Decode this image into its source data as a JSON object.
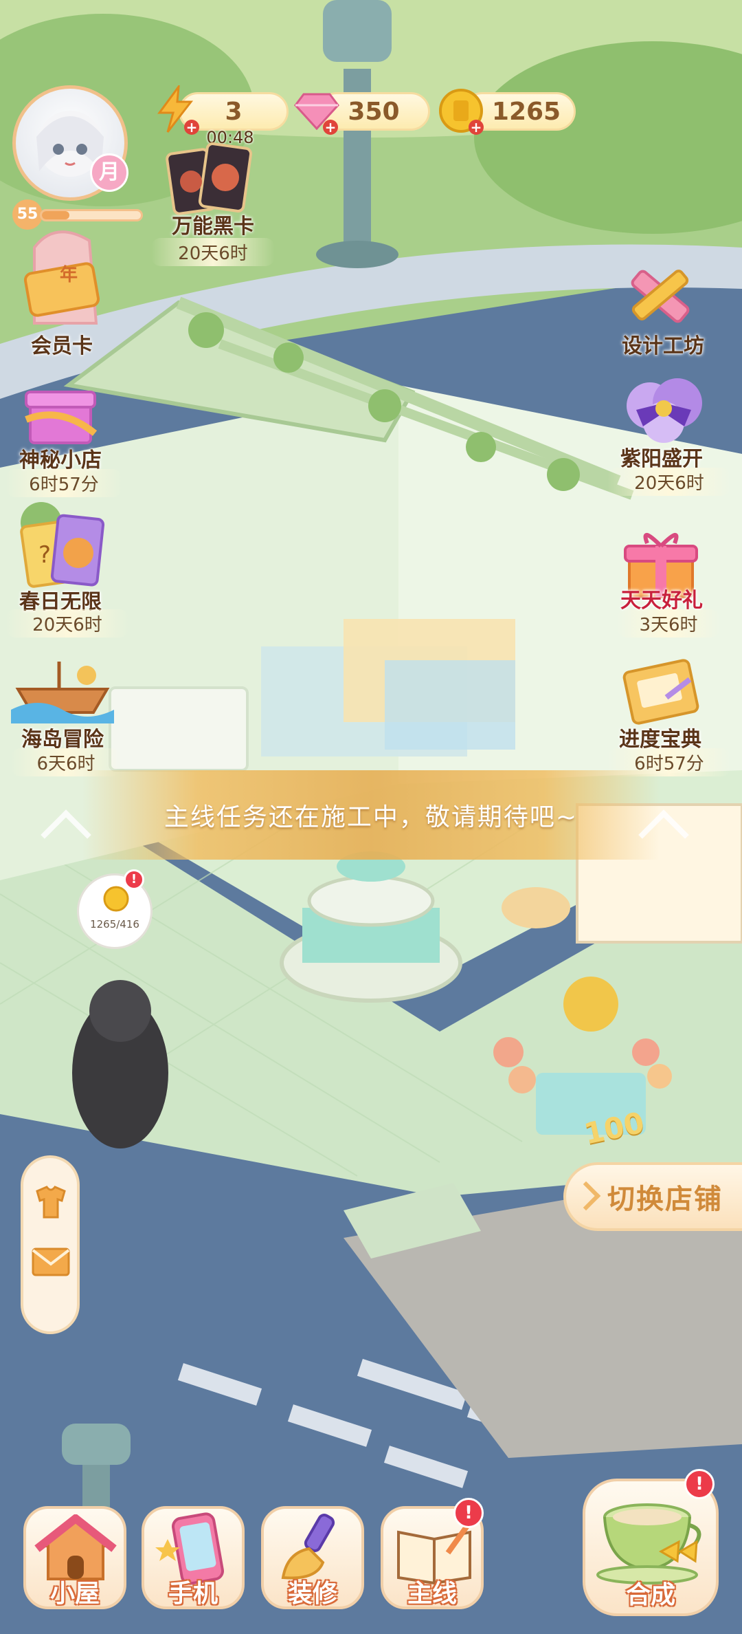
{
  "resources": {
    "energy": {
      "value": "3",
      "timer": "00:48"
    },
    "gems": {
      "value": "350"
    },
    "coins": {
      "value": "1265"
    }
  },
  "player": {
    "level": "55",
    "badge": "月"
  },
  "left_menu": [
    {
      "label": "万能黑卡",
      "timer": "20天6时"
    },
    {
      "label": "会员卡",
      "timer": ""
    },
    {
      "label": "神秘小店",
      "timer": "6时57分"
    },
    {
      "label": "春日无限",
      "timer": "20天6时"
    },
    {
      "label": "海岛冒险",
      "timer": "6天6时"
    }
  ],
  "right_menu": [
    {
      "label": "设计工坊",
      "timer": ""
    },
    {
      "label": "紫阳盛开",
      "timer": "20天6时"
    },
    {
      "label": "天天好礼",
      "timer": "3天6时"
    },
    {
      "label": "进度宝典",
      "timer": "6时57分"
    }
  ],
  "member_badge": "年",
  "banner": {
    "text": "主线任务还在施工中，敬请期待吧~"
  },
  "coin_bubble": {
    "text": "1265/416"
  },
  "switch_store": {
    "label": "切换店铺"
  },
  "statue_sign": "100",
  "bottom_nav": [
    {
      "label": "小屋"
    },
    {
      "label": "手机"
    },
    {
      "label": "装修"
    },
    {
      "label": "主线"
    },
    {
      "label": "合成"
    }
  ],
  "colors": {
    "accent": "#f0b860",
    "alert": "#ec3b4a",
    "label_dark": "#5a3418"
  }
}
